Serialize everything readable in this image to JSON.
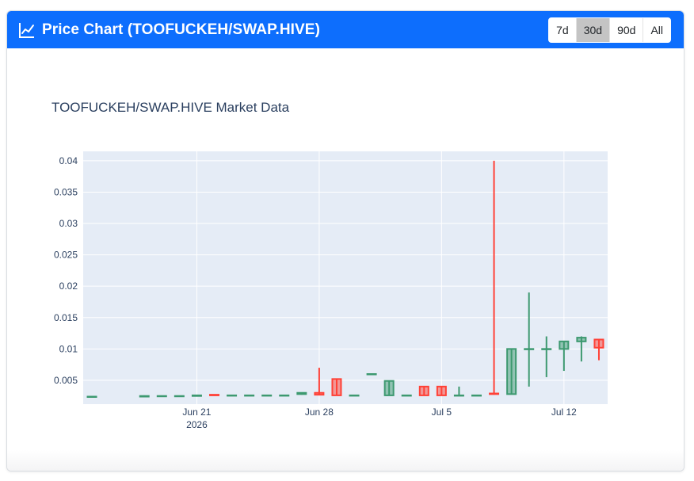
{
  "header": {
    "title": "Price Chart (TOOFUCKEH/SWAP.HIVE)",
    "icon": "line-chart-icon",
    "ranges": [
      "7d",
      "30d",
      "90d",
      "All"
    ],
    "active_range": "30d"
  },
  "colors": {
    "header_bg": "#0d6efd",
    "increasing": "#3d9970",
    "decreasing": "#ff4136",
    "plot_bg": "#e5ecf6"
  },
  "chart_data": {
    "type": "candlestick",
    "title": "TOOFUCKEH/SWAP.HIVE Market Data",
    "ylim": [
      0.0012,
      0.0415
    ],
    "yticks": [
      0.005,
      0.01,
      0.015,
      0.02,
      0.025,
      0.03,
      0.035,
      0.04
    ],
    "ytick_labels": [
      "0.005",
      "0.01",
      "0.015",
      "0.02",
      "0.025",
      "0.03",
      "0.035",
      "0.04"
    ],
    "xlim": [
      "2026-06-14T12:00",
      "2026-07-14T12:00"
    ],
    "xticks": [
      {
        "date": "2026-06-21",
        "label": "Jun 21",
        "sublabel": "2026"
      },
      {
        "date": "2026-06-28",
        "label": "Jun 28",
        "sublabel": ""
      },
      {
        "date": "2026-07-05",
        "label": "Jul 5",
        "sublabel": ""
      },
      {
        "date": "2026-07-12",
        "label": "Jul 12",
        "sublabel": ""
      }
    ],
    "grid": true,
    "candles": [
      {
        "date": "2026-06-15",
        "open": 0.0024,
        "high": 0.0024,
        "low": 0.0024,
        "close": 0.0024
      },
      {
        "date": "2026-06-18",
        "open": 0.0024,
        "high": 0.0026,
        "low": 0.0024,
        "close": 0.0025
      },
      {
        "date": "2026-06-19",
        "open": 0.0025,
        "high": 0.0025,
        "low": 0.0025,
        "close": 0.0025
      },
      {
        "date": "2026-06-20",
        "open": 0.0025,
        "high": 0.0025,
        "low": 0.0025,
        "close": 0.0025
      },
      {
        "date": "2026-06-21",
        "open": 0.0025,
        "high": 0.0026,
        "low": 0.0025,
        "close": 0.0026
      },
      {
        "date": "2026-06-22",
        "open": 0.0027,
        "high": 0.0027,
        "low": 0.0026,
        "close": 0.0026
      },
      {
        "date": "2026-06-23",
        "open": 0.0026,
        "high": 0.0026,
        "low": 0.0026,
        "close": 0.0026
      },
      {
        "date": "2026-06-24",
        "open": 0.0026,
        "high": 0.0026,
        "low": 0.0026,
        "close": 0.0026
      },
      {
        "date": "2026-06-25",
        "open": 0.0026,
        "high": 0.0026,
        "low": 0.0026,
        "close": 0.0026
      },
      {
        "date": "2026-06-26",
        "open": 0.0026,
        "high": 0.0026,
        "low": 0.0026,
        "close": 0.0026
      },
      {
        "date": "2026-06-27",
        "open": 0.0028,
        "high": 0.003,
        "low": 0.0027,
        "close": 0.003
      },
      {
        "date": "2026-06-28",
        "open": 0.003,
        "high": 0.007,
        "low": 0.0027,
        "close": 0.0027
      },
      {
        "date": "2026-06-29",
        "open": 0.0052,
        "high": 0.0052,
        "low": 0.0026,
        "close": 0.0026
      },
      {
        "date": "2026-06-30",
        "open": 0.0026,
        "high": 0.0026,
        "low": 0.0026,
        "close": 0.0026
      },
      {
        "date": "2026-07-01",
        "open": 0.006,
        "high": 0.006,
        "low": 0.006,
        "close": 0.006
      },
      {
        "date": "2026-07-02",
        "open": 0.0026,
        "high": 0.0049,
        "low": 0.0026,
        "close": 0.0049
      },
      {
        "date": "2026-07-03",
        "open": 0.0026,
        "high": 0.0026,
        "low": 0.0026,
        "close": 0.0026
      },
      {
        "date": "2026-07-04",
        "open": 0.004,
        "high": 0.004,
        "low": 0.0026,
        "close": 0.0026
      },
      {
        "date": "2026-07-05",
        "open": 0.004,
        "high": 0.004,
        "low": 0.0026,
        "close": 0.0026
      },
      {
        "date": "2026-07-06",
        "open": 0.0026,
        "high": 0.004,
        "low": 0.0026,
        "close": 0.0026
      },
      {
        "date": "2026-07-07",
        "open": 0.0026,
        "high": 0.0026,
        "low": 0.0026,
        "close": 0.0026
      },
      {
        "date": "2026-07-08",
        "open": 0.0029,
        "high": 0.04,
        "low": 0.0027,
        "close": 0.0028
      },
      {
        "date": "2026-07-09",
        "open": 0.0028,
        "high": 0.01,
        "low": 0.0028,
        "close": 0.01
      },
      {
        "date": "2026-07-10",
        "open": 0.01,
        "high": 0.019,
        "low": 0.004,
        "close": 0.01
      },
      {
        "date": "2026-07-11",
        "open": 0.01,
        "high": 0.012,
        "low": 0.0055,
        "close": 0.01
      },
      {
        "date": "2026-07-12",
        "open": 0.01,
        "high": 0.0112,
        "low": 0.0065,
        "close": 0.0112
      },
      {
        "date": "2026-07-13",
        "open": 0.0112,
        "high": 0.012,
        "low": 0.008,
        "close": 0.0118
      },
      {
        "date": "2026-07-14",
        "open": 0.0115,
        "high": 0.0115,
        "low": 0.0082,
        "close": 0.0102
      }
    ]
  }
}
